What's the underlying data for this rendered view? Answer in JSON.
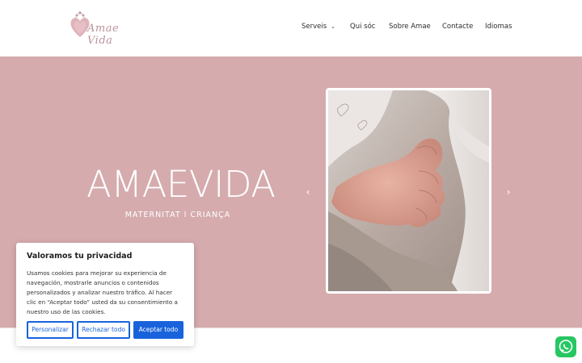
{
  "header": {
    "logo_text": "Amae Vida",
    "nav": [
      {
        "label": "Serveis"
      },
      {
        "label": "Qui sóc"
      },
      {
        "label": "Sobre Amae"
      },
      {
        "label": "Contacte"
      },
      {
        "label": "Idiomas"
      }
    ]
  },
  "hero": {
    "title": "AMAEVIDA",
    "subtitle": "MATERNITAT I CRIANÇA",
    "prev_arrow": "‹",
    "next_arrow": "›"
  },
  "cookie": {
    "title": "Valoramos tu privacidad",
    "body": "Usamos cookies para mejorar su experiencia de navegación, mostrarle anuncios o contenidos personalizados y analizar nuestro tráfico. Al hacer clic en “Aceptar todo” usted da su consentimiento a nuestro uso de las cookies.",
    "customize": "Personalizar",
    "reject": "Rechazar todo",
    "accept": "Aceptar todo"
  },
  "colors": {
    "hero_bg": "#d5abae",
    "accent_blue": "#1863dc",
    "whatsapp": "#26c763"
  }
}
